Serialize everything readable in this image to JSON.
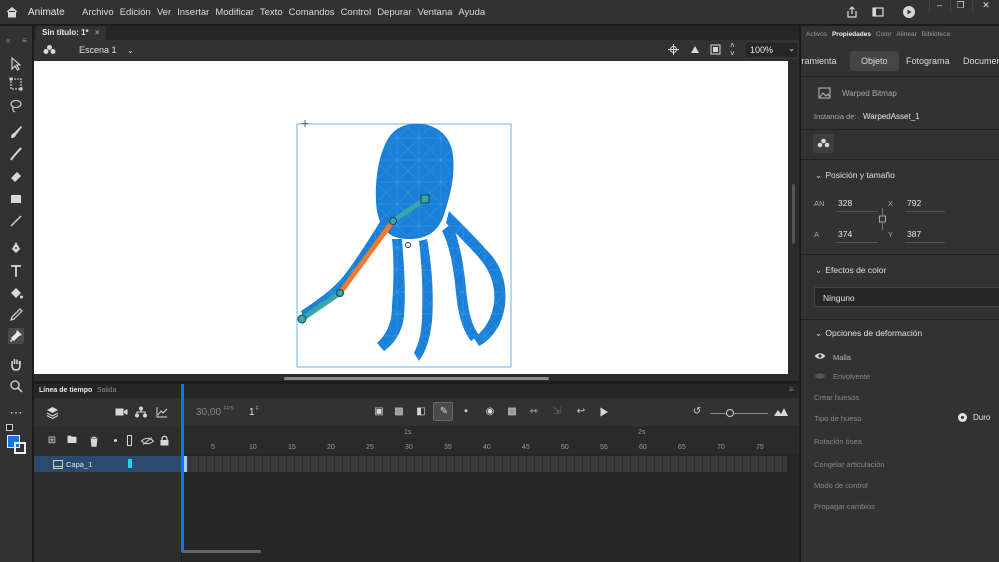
{
  "menubar": {
    "app_name": "Animate",
    "items": [
      "Archivo",
      "Edición",
      "Ver",
      "Insertar",
      "Modificar",
      "Texto",
      "Comandos",
      "Control",
      "Depurar",
      "Ventana",
      "Ayuda"
    ]
  },
  "document": {
    "tab_title": "Sin título: 1*",
    "scene_label": "Escena 1",
    "zoom": "100%"
  },
  "properties": {
    "panel_tabs": [
      "Activos",
      "Propiedades",
      "Color",
      "Alinear",
      "Biblioteca"
    ],
    "sub_tabs": [
      "Herramienta",
      "Objeto",
      "Fotograma",
      "Documento"
    ],
    "object_type": "Warped Bitmap",
    "instance_label": "Instancia de:",
    "instance_name": "WarpedAsset_1",
    "position_size_title": "Posición y tamaño",
    "w_label": "AN",
    "w_value": "328",
    "x_label": "X",
    "x_value": "792",
    "h_label": "A",
    "h_value": "374",
    "y_label": "Y",
    "y_value": "387",
    "color_effects_title": "Efectos de color",
    "color_effect_value": "Ninguno",
    "warp_options_title": "Opciones de deformación",
    "mesh_label": "Malla",
    "envelope_label": "Envolvente",
    "create_bones_label": "Crear huesos",
    "bone_type_label": "Tipo de hueso",
    "bone_type_value": "Duro",
    "bone_rotation_label": "Rotación ósea",
    "freeze_joint_label": "Congelar articulación",
    "control_mode_label": "Modo de control",
    "propagate_label": "Propagar cambios"
  },
  "timeline": {
    "tab_timeline": "Línea de tiempo",
    "tab_output": "Salida",
    "fps": "30,00",
    "fps_unit": "FPS",
    "frame": "1",
    "frame_unit": "F",
    "layer_name": "Capa_1",
    "frame_numbers": [
      "5",
      "10",
      "15",
      "20",
      "25",
      "30",
      "35",
      "40",
      "45",
      "50",
      "55",
      "60",
      "65",
      "70",
      "75"
    ],
    "second_markers": [
      "1s",
      "2s"
    ]
  },
  "colors": {
    "accent": "#1473e6",
    "mesh_fill": "#1a7fd8",
    "bone_highlight": "#f07b2c",
    "bone_normal": "#37a6a6",
    "layer_selected": "#2a4a6e"
  }
}
